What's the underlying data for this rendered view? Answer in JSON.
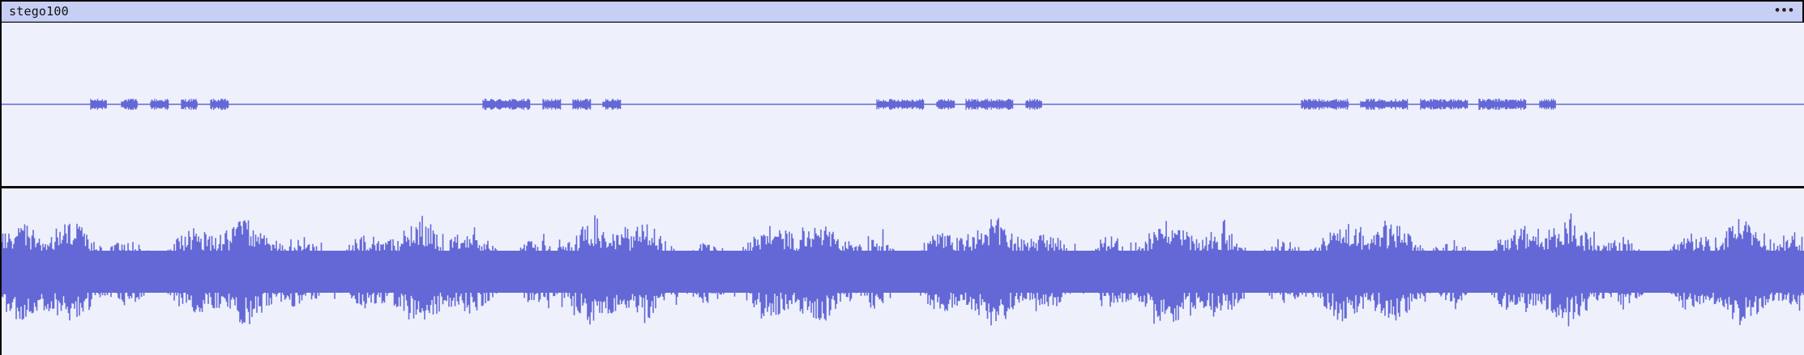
{
  "track": {
    "name": "stego100",
    "menu_glyph": "•••"
  },
  "colors": {
    "waveform": "#6468d6",
    "lane_bg": "#eef1fc",
    "title_bg": "#c8cff5"
  },
  "icons": {
    "menu": "more-dots-icon"
  }
}
